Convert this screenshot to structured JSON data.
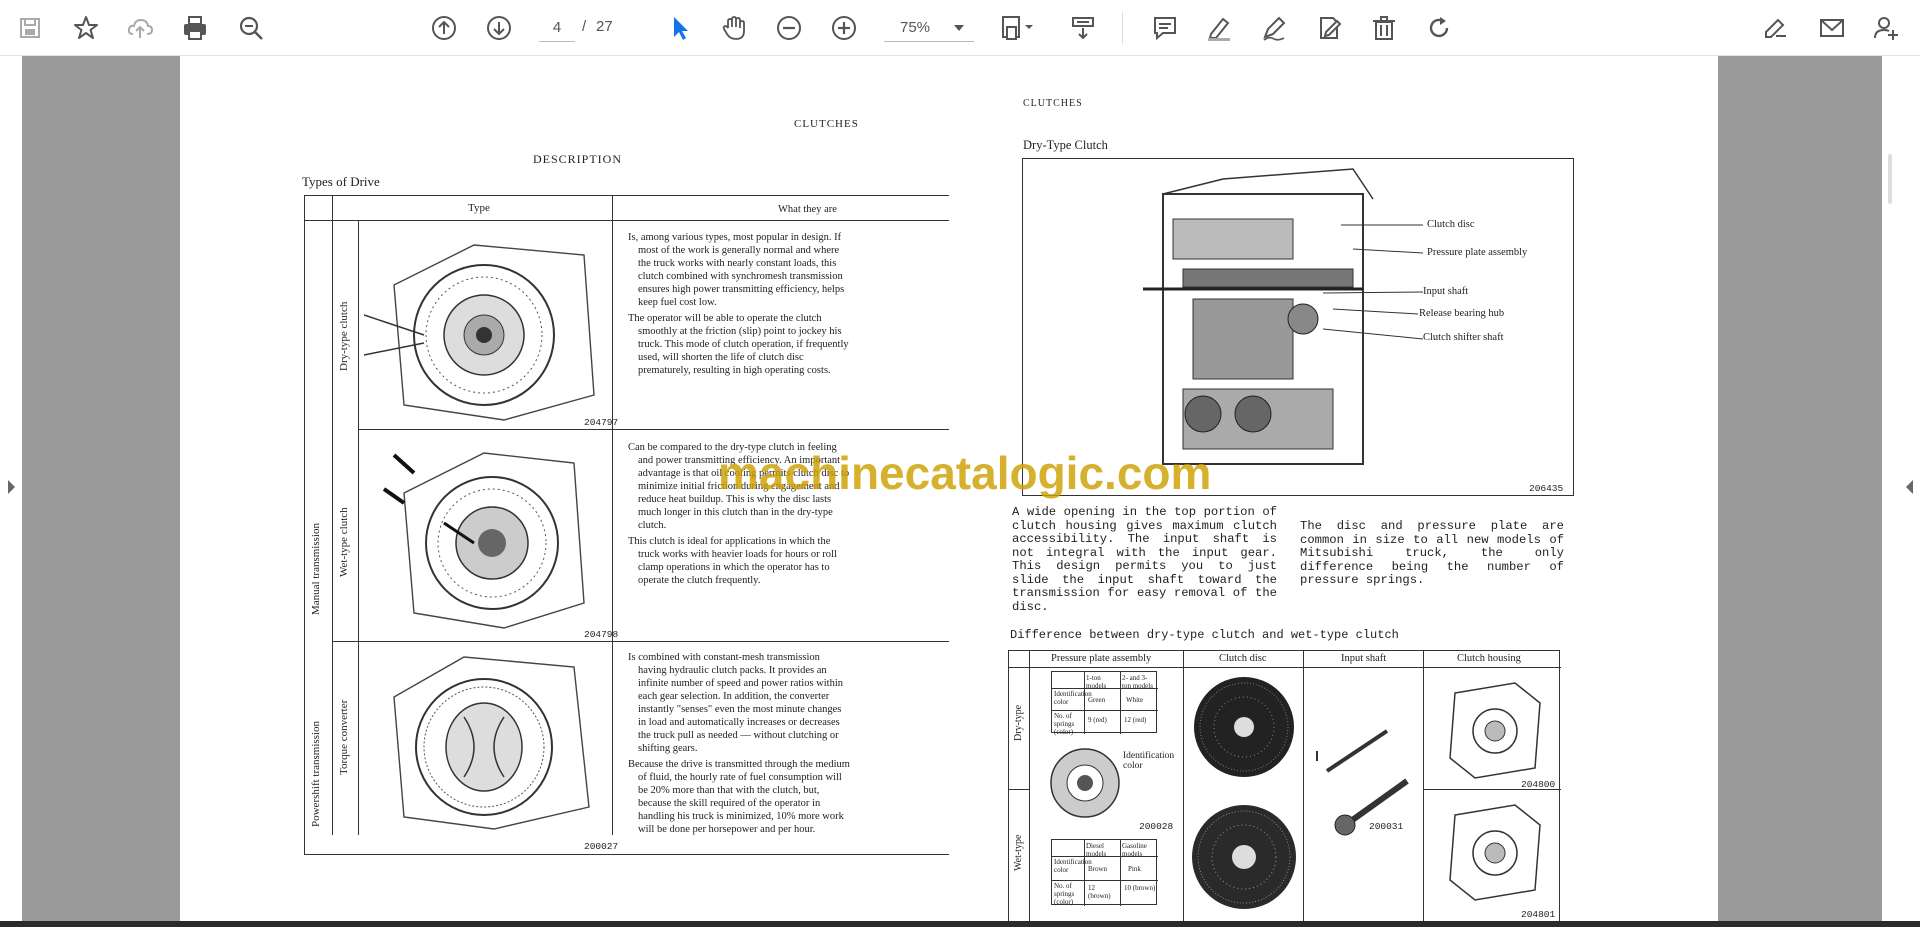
{
  "toolbar": {
    "page_current": "4",
    "page_separator": "/",
    "page_total": "27",
    "zoom": "75%",
    "icons": [
      "save-icon",
      "bookmark-star-icon",
      "cloud-upload-icon",
      "print-icon",
      "zoom-search-icon",
      "page-up-icon",
      "page-down-icon",
      "select-cursor-icon",
      "hand-pan-icon",
      "zoom-out-icon",
      "zoom-in-icon",
      "page-fit-icon",
      "scroll-mode-icon",
      "comment-icon",
      "highlight-pen-icon",
      "draw-pen-icon",
      "sign-icon",
      "delete-icon",
      "rotate-icon",
      "edit-pdf-icon",
      "email-icon",
      "add-user-icon"
    ],
    "accent_color": "#1473e6"
  },
  "left_page": {
    "header": "CLUTCHES",
    "section_title": "DESCRIPTION",
    "subtitle": "Types of Drive",
    "col_type": "Type",
    "col_what": "What they are",
    "group_manual": "Manual transmission",
    "group_powershift": "Powershift transmission",
    "rows": [
      {
        "label": "Dry-type clutch",
        "figure": "204797",
        "bullets": [
          "Is, among various types, most popular in design. If most of the work is generally normal and where the truck works with nearly constant loads, this clutch combined with synchromesh transmission ensures high power transmitting efficiency, helps keep fuel cost low.",
          "The operator will be able to operate the clutch smoothly at the friction (slip) point to jockey his truck. This mode of clutch operation, if frequently used, will shorten the life of clutch disc prematurely, resulting in high operating costs."
        ]
      },
      {
        "label": "Wet-type clutch",
        "figure": "204798",
        "bullets": [
          "Can be compared to the dry-type clutch in feeling and power transmitting efficiency. An important advantage is that oil cooling permits clutch disc to minimize initial friction during engagement and reduce heat buildup. This is why the disc lasts much longer in this clutch than in the dry-type clutch.",
          "This clutch is ideal for applications in which the truck works with heavier loads for hours or roll clamp operations in which the operator has to operate the clutch frequently."
        ]
      },
      {
        "label": "Torque converter",
        "figure": "200027",
        "bullets": [
          "Is combined with constant-mesh transmission having hydraulic clutch packs. It provides an infinite number of speed and power ratios within each gear selection. In addition, the converter instantly \"senses\" even the most minute changes in load and automatically increases or decreases the truck pull as needed — without clutching or shifting gears.",
          "Because the drive is transmitted through the medium of fluid, the hourly rate of fuel consumption will be 20% more than that with the clutch, but, because the skill required of the operator in handling his truck is minimized, 10% more work will be done per horsepower and per hour."
        ]
      }
    ]
  },
  "right_page": {
    "header": "CLUTCHES",
    "subtitle": "Dry-Type Clutch",
    "callouts": [
      "Clutch disc",
      "Pressure plate assembly",
      "Input shaft",
      "Release bearing hub",
      "Clutch shifter shaft"
    ],
    "figure_main": "206435",
    "para_left": "A wide opening in the top portion of clutch housing gives maximum clutch accessibility. The input shaft is not integral with the input gear. This design permits you to just slide the input shaft toward the transmission for easy removal of the disc.",
    "para_right": "The disc and pressure plate are common in size to all new models of Mitsubishi truck, the only difference being the number of pressure springs.",
    "diff_title": "Difference between dry-type clutch and wet-type clutch",
    "diff_cols": [
      "Pressure plate assembly",
      "Clutch disc",
      "Input shaft",
      "Clutch housing"
    ],
    "diff_rows": [
      "Dry-type",
      "Wet-type"
    ],
    "dry_mini": {
      "head": [
        "1-ton models",
        "2- and 3-ton models"
      ],
      "r1_label": "Identification color",
      "r1": [
        "Green",
        "White"
      ],
      "r2_label": "No. of springs (color)",
      "r2": [
        "9 (red)",
        "12 (red)"
      ]
    },
    "wet_mini": {
      "head": [
        "Diesel models",
        "Gasoline models"
      ],
      "r1_label": "Identification color",
      "r1": [
        "Brown",
        "Pink"
      ],
      "r2_label": "No. of springs (color)",
      "r2": [
        "12 (brown)",
        "10 (brown)"
      ]
    },
    "ident_label": "Identification color",
    "fig_pp": "200028",
    "fig_shaft": "200031",
    "fig_house_top": "204800",
    "fig_house_bot": "204801"
  },
  "watermark": "machinecatalogic.com"
}
